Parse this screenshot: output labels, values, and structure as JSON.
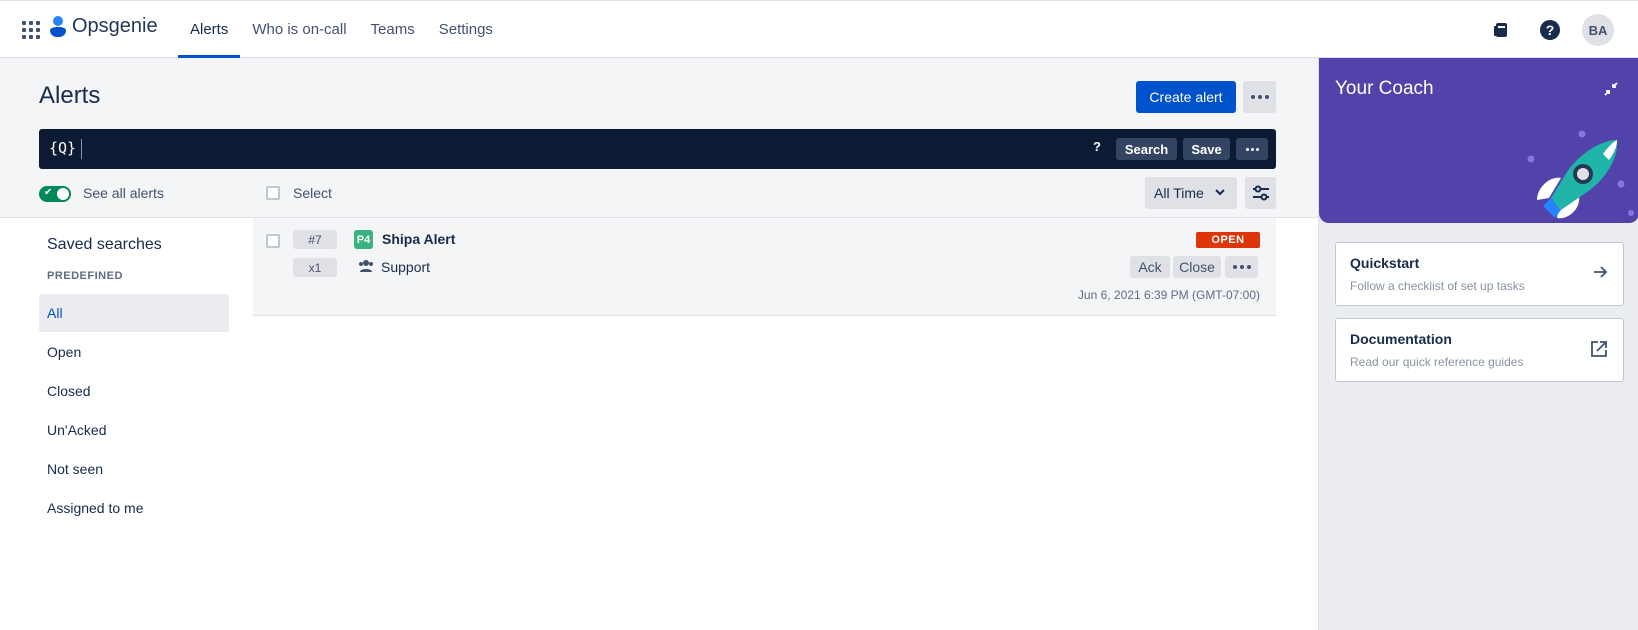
{
  "app": {
    "name": "Opsgenie"
  },
  "nav": {
    "items": [
      {
        "label": "Alerts",
        "active": true
      },
      {
        "label": "Who is on-call",
        "active": false
      },
      {
        "label": "Teams",
        "active": false
      },
      {
        "label": "Settings",
        "active": false
      }
    ],
    "user_initials": "BA"
  },
  "page": {
    "title": "Alerts",
    "create_label": "Create alert"
  },
  "search": {
    "icon_text": "{Q}",
    "placeholder": "",
    "help_label": "?",
    "search_label": "Search",
    "save_label": "Save"
  },
  "filters": {
    "see_all_label": "See all alerts",
    "see_all_on": true,
    "select_label": "Select",
    "time_range": "All Time"
  },
  "saved_searches": {
    "title": "Saved searches",
    "section": "PREDEFINED",
    "items": [
      {
        "label": "All",
        "active": true
      },
      {
        "label": "Open",
        "active": false
      },
      {
        "label": "Closed",
        "active": false
      },
      {
        "label": "Un'Acked",
        "active": false
      },
      {
        "label": "Not seen",
        "active": false
      },
      {
        "label": "Assigned to me",
        "active": false
      }
    ]
  },
  "alerts": [
    {
      "number": "#7",
      "count": "x1",
      "priority": "P4",
      "title": "Shipa Alert",
      "team": "Support",
      "status": "OPEN",
      "ack_label": "Ack",
      "close_label": "Close",
      "date": "Jun 6, 2021 6:39 PM (GMT-07:00)"
    }
  ],
  "coach": {
    "title": "Your Coach",
    "cards": [
      {
        "title": "Quickstart",
        "subtitle": "Follow a checklist of set up tasks"
      },
      {
        "title": "Documentation",
        "subtitle": "Read our quick reference guides"
      }
    ]
  },
  "colors": {
    "primary": "#0052CC",
    "search_bg": "#0C1A33",
    "coach_bg": "#5243AA",
    "open_status": "#DE350B",
    "priority_p4": "#36B37E",
    "toggle_on": "#00875A"
  },
  "icons": {
    "apps": "apps-grid-icon",
    "logo": "opsgenie-logo-icon",
    "book": "book-icon",
    "help": "help-icon",
    "more": "more-icon",
    "filter": "filter-icon",
    "chevron": "chevron-down-icon",
    "team": "people-icon",
    "collapse": "collapse-icon",
    "arrow": "arrow-right-icon",
    "external": "external-link-icon",
    "rocket": "rocket-illustration"
  }
}
